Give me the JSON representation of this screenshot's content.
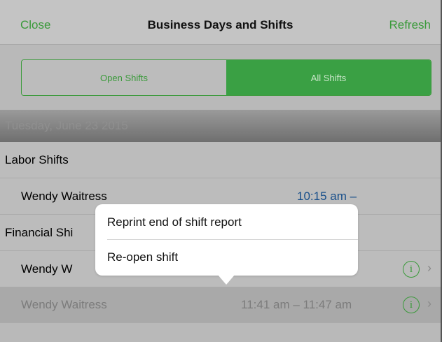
{
  "navbar": {
    "left_button": "Close",
    "title": "Business Days and Shifts",
    "right_button": "Refresh"
  },
  "segmented": {
    "options": [
      "Open Shifts",
      "All Shifts"
    ],
    "selected": "All Shifts"
  },
  "date_header": "Tuesday, June 23 2015",
  "sections": {
    "labor": {
      "title": "Labor Shifts",
      "rows": [
        {
          "name": "Wendy Waitress",
          "time": "10:15 am  –"
        }
      ]
    },
    "financial": {
      "title": "Financial Shi",
      "rows": [
        {
          "name": "Wendy W",
          "info_icon": "info-icon",
          "chevron": "chevron-right-icon"
        },
        {
          "name": "Wendy Waitress",
          "time": "11:41 am  –  11:47 am",
          "info_icon": "info-icon",
          "chevron": "chevron-right-icon"
        }
      ]
    }
  },
  "popover": {
    "items": [
      "Reprint end of shift report",
      "Re-open shift"
    ]
  },
  "colors": {
    "accent": "#3a9a3a",
    "time_text": "#184f8a"
  }
}
